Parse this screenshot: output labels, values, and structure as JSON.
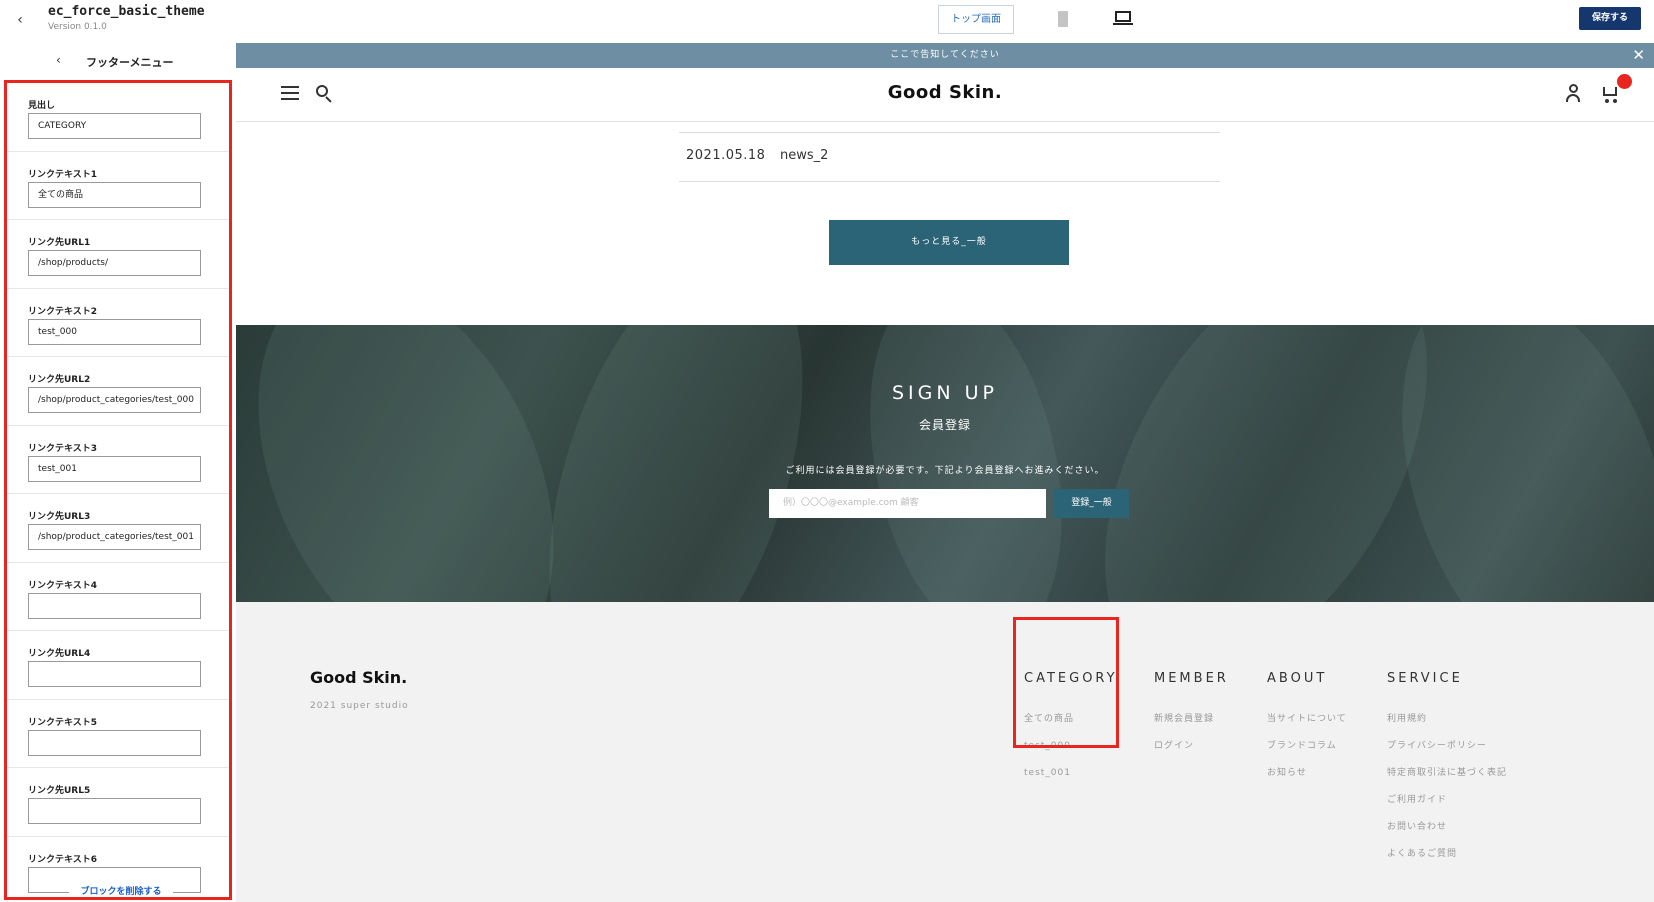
{
  "topbar": {
    "back_icon": "chevron-left-icon",
    "title": "ec_force_basic_theme",
    "version": "Version 0.1.0",
    "top_screen_label": "トップ画面",
    "mobile_icon": "mobile-icon",
    "desktop_icon": "desktop-icon",
    "save_label": "保存する"
  },
  "sidebar": {
    "back_icon": "chevron-left-icon",
    "title": "フッターメニュー",
    "fields": [
      {
        "label": "見出し",
        "value": ""
      },
      {
        "label": "リンクテキスト1",
        "value": "CATEGORY"
      },
      {
        "label": "リンク先URL1",
        "value": "全ての商品"
      },
      {
        "label": "リンクテキスト2",
        "value": "/shop/products/"
      },
      {
        "label": "リンク先URL2",
        "value": "test_000"
      },
      {
        "label": "リンクテキスト3",
        "value": "/shop/product_categories/test_000"
      },
      {
        "label": "リンク先URL3",
        "value": "test_001"
      },
      {
        "label": "リンクテキスト4",
        "value": "/shop/product_categories/test_001"
      },
      {
        "label": "リンク先URL4",
        "value": ""
      },
      {
        "label": "リンクテキスト5",
        "value": ""
      },
      {
        "label": "リンク先URL5",
        "value": ""
      },
      {
        "label": "リンクテキスト6",
        "value": ""
      }
    ],
    "delete_label": "ブロックを削除する"
  },
  "preview": {
    "notice": "ここで告知してください",
    "close_icon": "close-icon",
    "logo": "Good Skin.",
    "news": {
      "date": "2021.05.18",
      "title": "news_2"
    },
    "more_label": "もっと見る_一般",
    "signup": {
      "title": "SIGN UP",
      "subtitle": "会員登録",
      "description": "ご利用には会員登録が必要です。下記より会員登録へお進みください。",
      "placeholder": "例）〇〇〇@example.com  顧客",
      "button": "登録_一般"
    },
    "footer": {
      "logo": "Good Skin.",
      "copyright": "2021 super studio",
      "columns": [
        {
          "heading": "CATEGORY",
          "links": [
            "全ての商品",
            "test_000",
            "test_001"
          ]
        },
        {
          "heading": "MEMBER",
          "links": [
            "新規会員登録",
            "ログイン"
          ]
        },
        {
          "heading": "ABOUT",
          "links": [
            "当サイトについて",
            "ブランドコラム",
            "お知らせ"
          ]
        },
        {
          "heading": "SERVICE",
          "links": [
            "利用規約",
            "プライバシーポリシー",
            "特定商取引法に基づく表記",
            "ご利用ガイド",
            "お問い合わせ",
            "よくあるご質問"
          ]
        }
      ]
    }
  },
  "colors": {
    "highlight": "#e8261f",
    "save_button": "#16366e",
    "notice_bar": "#6e8ea3",
    "primary_button": "#2c6477",
    "footer_bg": "#f2f2f2"
  }
}
